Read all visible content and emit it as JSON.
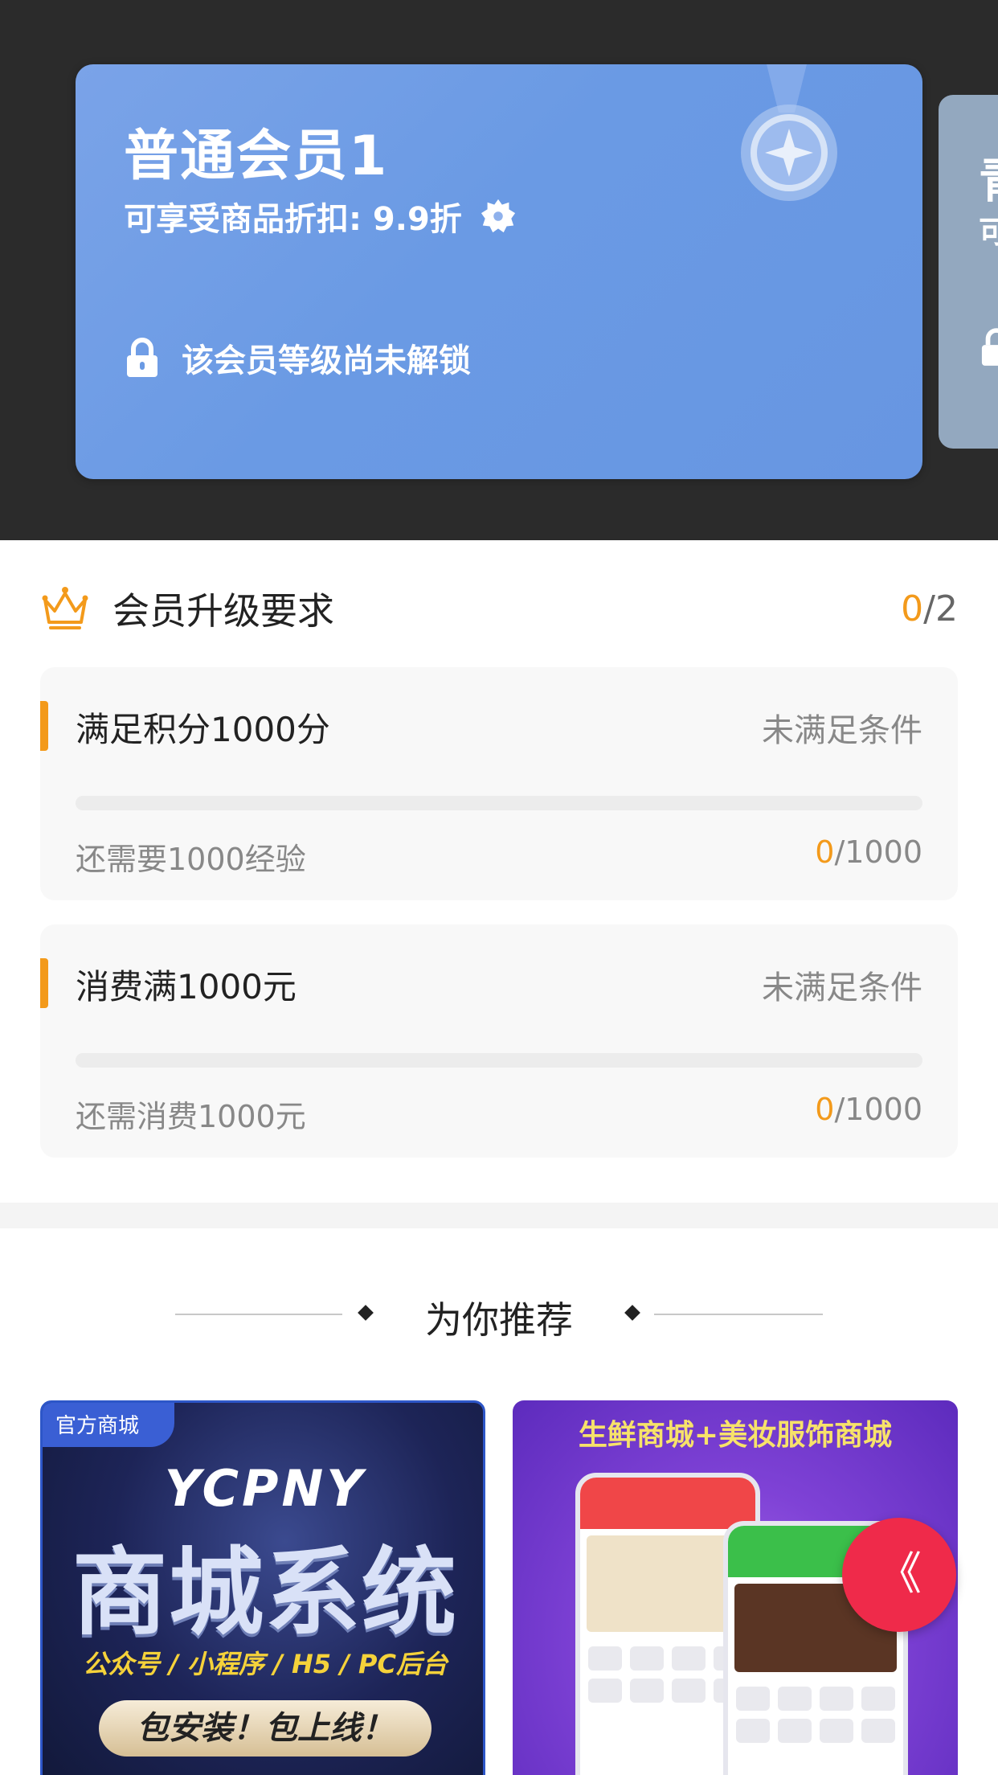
{
  "current_level": {
    "name": "普通会员1",
    "discount_text": "可享受商品折扣: 9.9折",
    "lock_text": "该会员等级尚未解锁"
  },
  "next_level": {
    "name_partial": "青",
    "sub_partial": "可"
  },
  "requirements": {
    "title": "会员升级要求",
    "done_count": "0",
    "total_suffix": "/2",
    "items": [
      {
        "title": "满足积分1000分",
        "status": "未满足条件",
        "need_text": "还需要1000经验",
        "current": "0",
        "target_suffix": "/1000",
        "progress_fraction": 0
      },
      {
        "title": "消费满1000元",
        "status": "未满足条件",
        "need_text": "还需消费1000元",
        "current": "0",
        "target_suffix": "/1000",
        "progress_fraction": 0
      }
    ]
  },
  "recommend": {
    "title": "为你推荐",
    "products": [
      {
        "tag": "官方商城",
        "brand": "YCPNY",
        "headline": "商城系统",
        "subline": "公众号 / 小程序 / H5 / PC后台",
        "pill": "包安装！包上线！"
      },
      {
        "banner": "生鲜商城+美妆服饰商城"
      }
    ]
  },
  "float_button": {
    "label": "《"
  },
  "colors": {
    "accent": "#f39a1b",
    "card_blue": "#6a9ae4",
    "dark_bg": "#2b2b2b",
    "float_red": "#ef2a4a"
  }
}
